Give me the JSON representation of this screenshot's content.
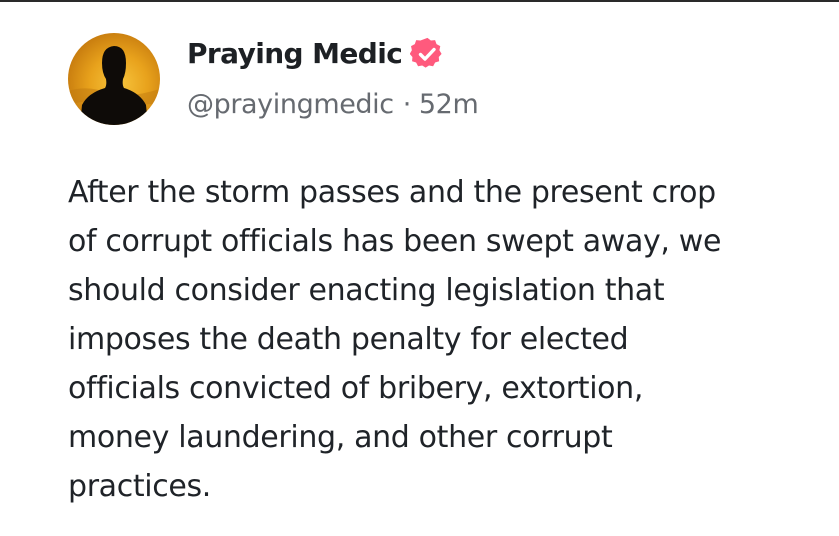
{
  "post": {
    "author": {
      "display_name": "Praying Medic",
      "handle": "@prayingmedic",
      "separator": "·",
      "time_ago": "52m",
      "verified_color": "#ff5a7d"
    },
    "text": "After the storm passes and the present crop\nof corrupt officials has been swept away, we\nshould consider enacting legislation that\nimposes the death penalty for elected\nofficials convicted of bribery, extortion,\nmoney laundering, and other corrupt\npractices."
  }
}
